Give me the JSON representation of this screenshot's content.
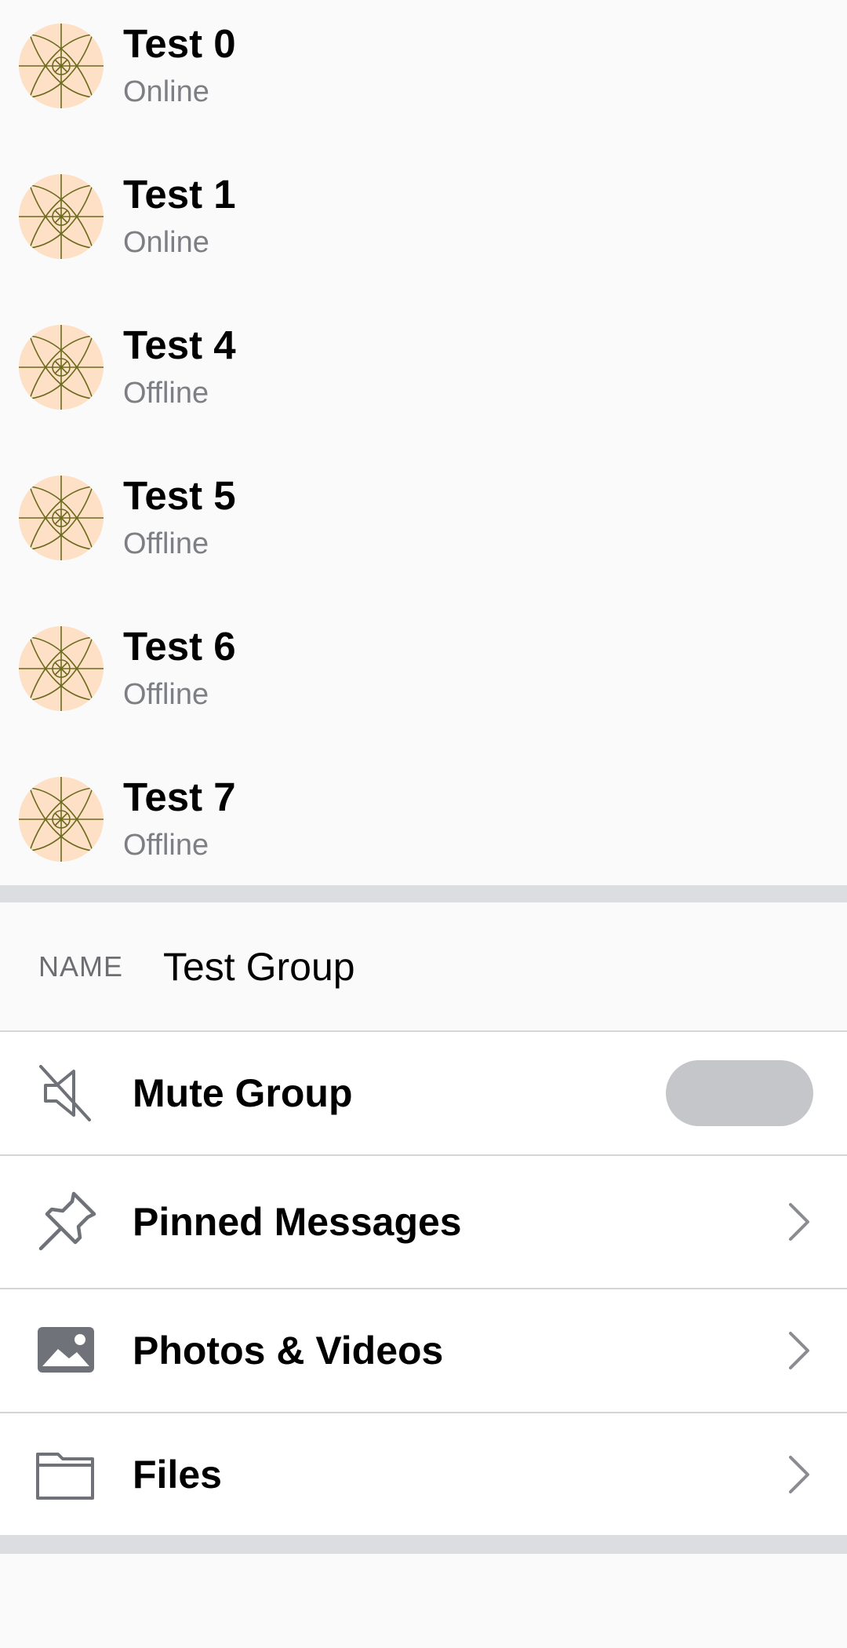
{
  "members": [
    {
      "name": "Test 0",
      "status": "Online"
    },
    {
      "name": "Test 1",
      "status": "Online"
    },
    {
      "name": "Test 4",
      "status": "Offline"
    },
    {
      "name": "Test 5",
      "status": "Offline"
    },
    {
      "name": "Test 6",
      "status": "Offline"
    },
    {
      "name": "Test 7",
      "status": "Offline"
    }
  ],
  "group": {
    "name_label": "NAME",
    "name_value": "Test Group"
  },
  "settings": {
    "mute": {
      "label": "Mute Group",
      "icon": "muted-speaker-icon",
      "enabled": false
    },
    "pinned": {
      "label": "Pinned Messages",
      "icon": "pin-icon"
    },
    "photos": {
      "label": "Photos & Videos",
      "icon": "image-icon"
    },
    "files": {
      "label": "Files",
      "icon": "folder-icon"
    }
  },
  "colors": {
    "avatar_bg": "#fde0c6",
    "avatar_lines": "#6b6b1e",
    "status_text": "#7d7f85",
    "toggle_off": "#c5c6c9",
    "icon_gray": "#6f7278",
    "separator": "#dcdde0"
  }
}
